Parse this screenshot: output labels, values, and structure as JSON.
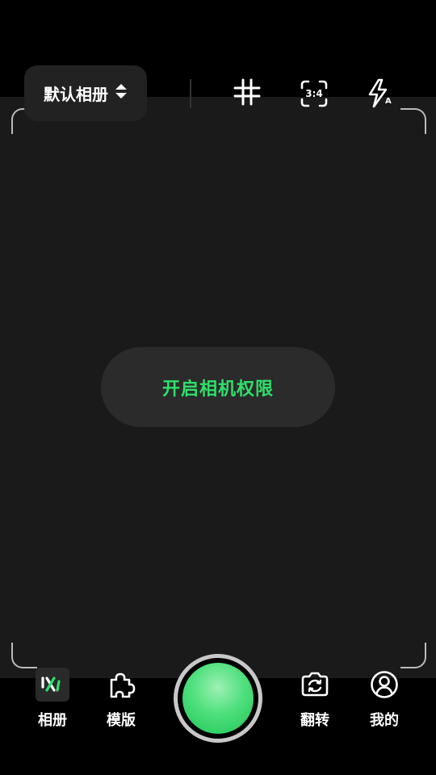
{
  "header": {
    "album_selector_label": "默认相册",
    "aspect_ratio_label": "3:4",
    "flash_mode_label": "A"
  },
  "viewfinder": {
    "permission_button_label": "开启相机权限"
  },
  "bottom_nav": {
    "album_label": "相册",
    "template_label": "模版",
    "flip_label": "翻转",
    "profile_label": "我的"
  },
  "colors": {
    "accent_green": "#2ee06a",
    "viewfinder_bg": "#1a1a1a",
    "background": "#000000"
  },
  "icons": {
    "album_selector": "sort-updown-icon",
    "grid": "grid-icon",
    "aspect_ratio": "aspect-ratio-icon",
    "flash": "flash-auto-icon",
    "album": "album-logo-icon",
    "template": "puzzle-icon",
    "flip": "camera-flip-icon",
    "profile": "user-circle-icon"
  }
}
